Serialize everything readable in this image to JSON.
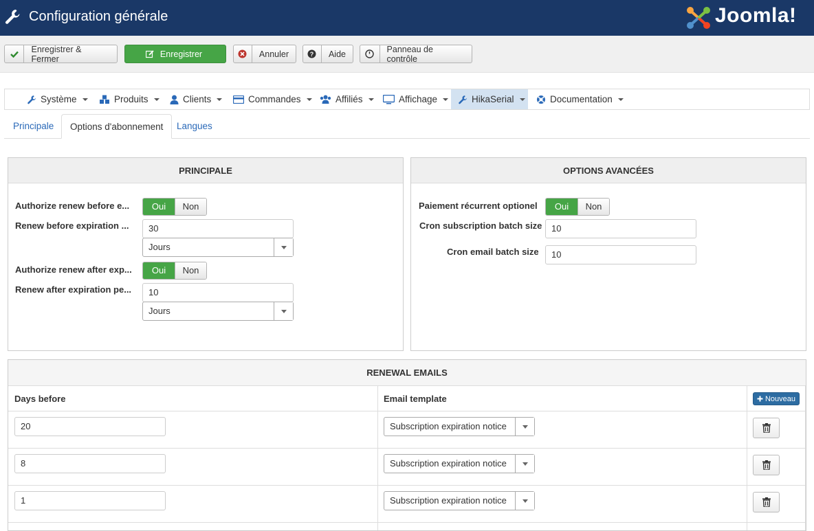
{
  "header": {
    "title": "Configuration générale",
    "brand": "Joomla!"
  },
  "toolbar": {
    "save_close": "Enregistrer & Fermer",
    "save": "Enregistrer",
    "cancel": "Annuler",
    "help": "Aide",
    "control_panel": "Panneau de contrôle"
  },
  "nav": {
    "items": [
      {
        "label": "Système"
      },
      {
        "label": "Produits"
      },
      {
        "label": "Clients"
      },
      {
        "label": "Commandes"
      },
      {
        "label": "Affiliés"
      },
      {
        "label": "Affichage"
      },
      {
        "label": "HikaSerial",
        "active": true
      },
      {
        "label": "Documentation"
      }
    ]
  },
  "tabs": [
    {
      "label": "Principale"
    },
    {
      "label": "Options d'abonnement",
      "active": true
    },
    {
      "label": "Langues"
    }
  ],
  "principale": {
    "title": "PRINCIPALE",
    "renew_before_label": "Authorize renew before e...",
    "renew_before_period_label": "Renew before expiration ...",
    "renew_before_period_value": "30",
    "renew_before_unit": "Jours",
    "renew_after_label": "Authorize renew after exp...",
    "renew_after_period_label": "Renew after expiration pe...",
    "renew_after_period_value": "10",
    "renew_after_unit": "Jours",
    "yes": "Oui",
    "no": "Non"
  },
  "advanced": {
    "title": "OPTIONS AVANCÉES",
    "recurring_label": "Paiement récurrent optionel",
    "cron_sub_label": "Cron subscription batch size",
    "cron_sub_value": "10",
    "cron_email_label": "Cron email batch size",
    "cron_email_value": "10"
  },
  "renewal": {
    "title": "RENEWAL EMAILS",
    "col_days": "Days before",
    "col_template": "Email template",
    "new_button": "Nouveau",
    "rows": [
      {
        "days": "20",
        "template": "Subscription expiration notice"
      },
      {
        "days": "8",
        "template": "Subscription expiration notice"
      },
      {
        "days": "1",
        "template": "Subscription expiration notice"
      }
    ]
  },
  "colors": {
    "header_bg": "#1a3867",
    "green": "#46a546",
    "link": "#2a69b8",
    "active_nav": "#d3e2f1"
  }
}
